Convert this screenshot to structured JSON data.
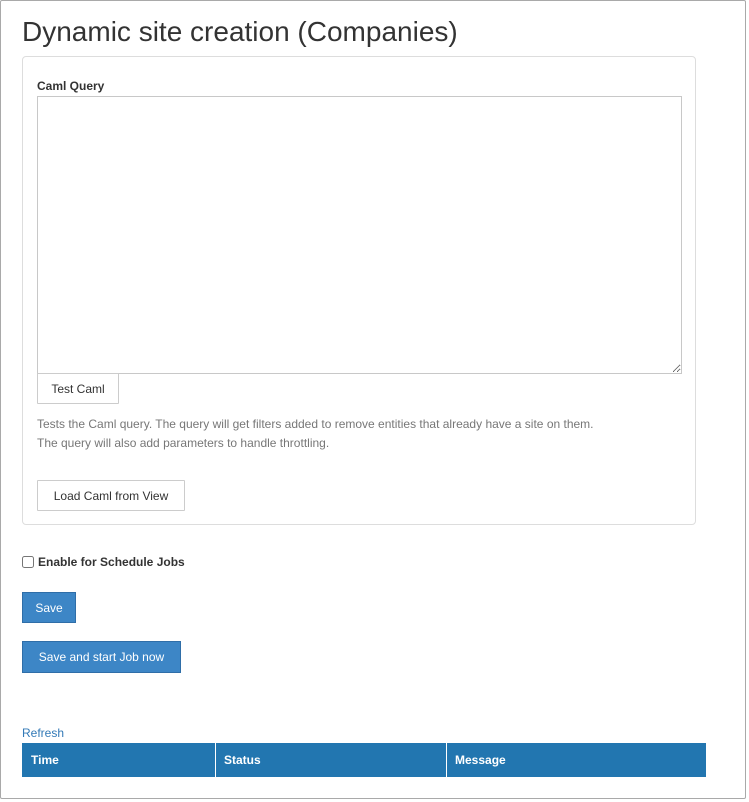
{
  "page": {
    "title": "Dynamic site creation (Companies)"
  },
  "caml_panel": {
    "label": "Caml Query",
    "query_value": "",
    "test_button": "Test Caml",
    "help_line_1": "Tests the Caml query. The query will get filters added to remove entities that already have a site on them.",
    "help_line_2": "The query will also add parameters to handle throttling.",
    "load_button": "Load Caml from View"
  },
  "schedule": {
    "checkbox_label": "Enable for Schedule Jobs",
    "checked": false
  },
  "actions": {
    "save": "Save",
    "save_and_start": "Save and start Job now"
  },
  "jobs": {
    "refresh_label": "Refresh",
    "columns": [
      "Time",
      "Status",
      "Message"
    ],
    "rows": []
  },
  "colors": {
    "primary_button": "#3d86c6",
    "table_header": "#2276b0",
    "link": "#337ab7"
  }
}
